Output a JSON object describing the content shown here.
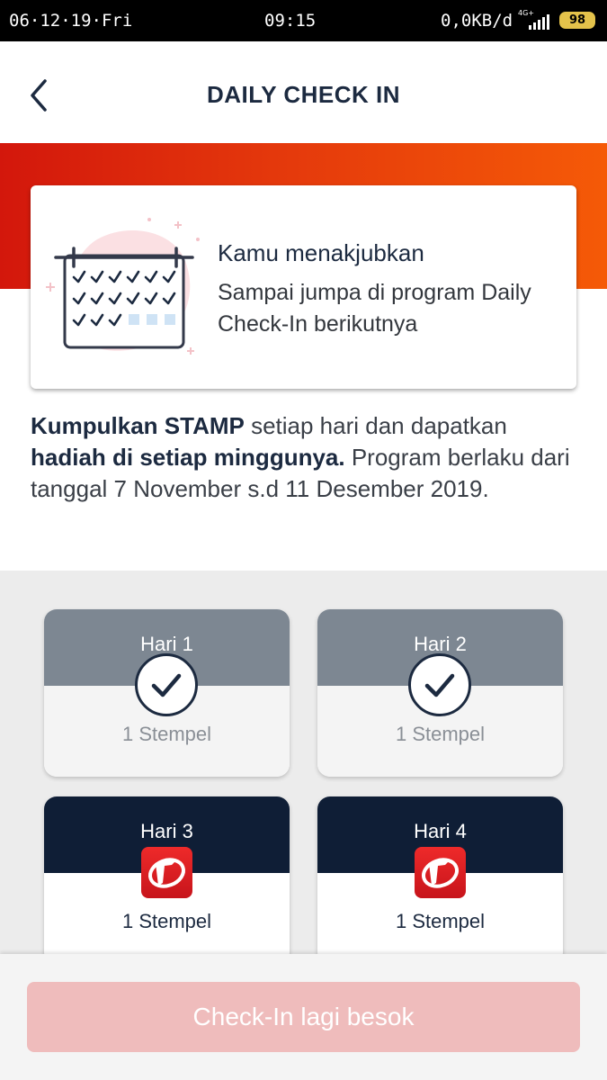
{
  "status_bar": {
    "date": "06·12·19·Fri",
    "time": "09:15",
    "speed": "0,0KB/d",
    "network": "4G+",
    "battery": "98"
  },
  "header": {
    "title": "DAILY CHECK IN",
    "back_icon": "chevron-left-icon"
  },
  "hero": {
    "title": "Kamu menakjubkan",
    "message": "Sampai jumpa di program Daily Check-In berikutnya",
    "illustration_icon": "calendar-icon"
  },
  "description": {
    "bold1": "Kumpulkan STAMP",
    "text1": " setiap hari dan dapatkan ",
    "bold2": "hadiah di setiap minggunya.",
    "text2": " Program berlaku dari tanggal 7 November s.d 11 Desember 2019."
  },
  "days": [
    {
      "label": "Hari 1",
      "stamp": "1 Stempel",
      "status": "done",
      "icon": "check-icon"
    },
    {
      "label": "Hari 2",
      "stamp": "1 Stempel",
      "status": "done",
      "icon": "check-icon"
    },
    {
      "label": "Hari 3",
      "stamp": "1 Stempel",
      "status": "pending",
      "icon": "telkomsel-logo-icon"
    },
    {
      "label": "Hari 4",
      "stamp": "1 Stempel",
      "status": "pending",
      "icon": "telkomsel-logo-icon"
    }
  ],
  "footer": {
    "button_label": "Check-In lagi besok",
    "button_color": "#efbcbc"
  },
  "colors": {
    "navy": "#0f1e36",
    "done_gray": "#7d8792",
    "brand_red": "#d3170c",
    "brand_orange": "#f55a07"
  }
}
